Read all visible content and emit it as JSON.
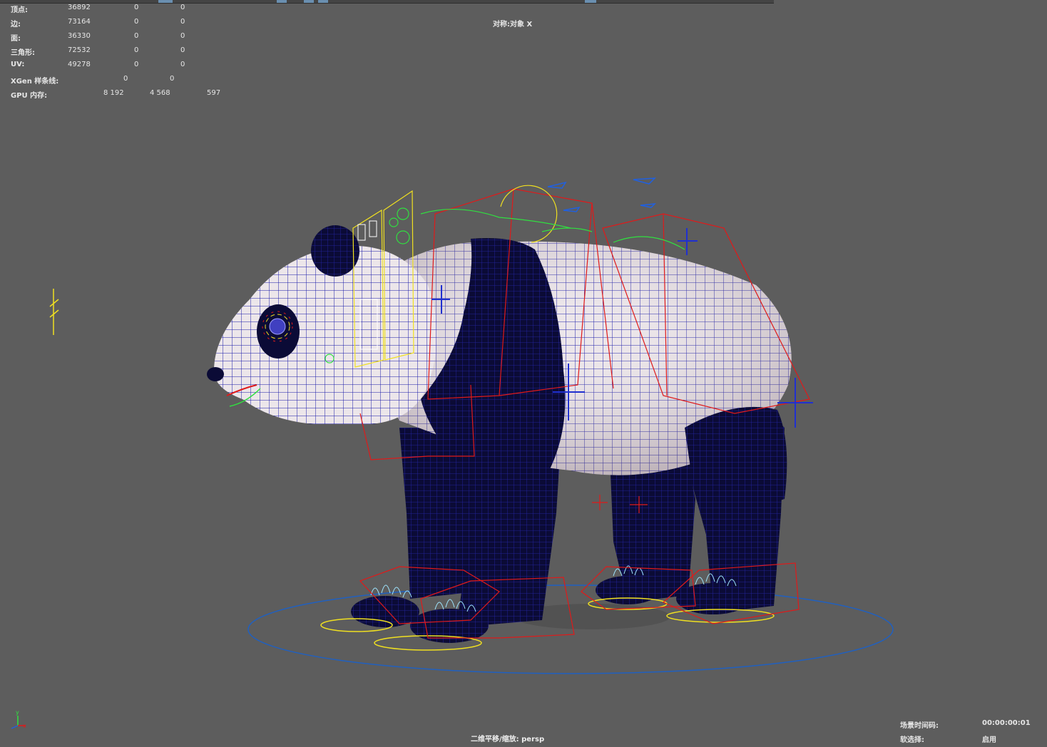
{
  "hud": {
    "rows": [
      {
        "label": "顶点:",
        "values": [
          "36892",
          "0",
          "0"
        ]
      },
      {
        "label": "边:",
        "values": [
          "73164",
          "0",
          "0"
        ]
      },
      {
        "label": "面:",
        "values": [
          "36330",
          "0",
          "0"
        ]
      },
      {
        "label": "三角形:",
        "values": [
          "72532",
          "0",
          "0"
        ]
      },
      {
        "label": "UV:",
        "values": [
          "49278",
          "0",
          "0"
        ]
      },
      {
        "label": "XGen 样条线:",
        "values": [
          "",
          "0",
          "0"
        ]
      },
      {
        "label": "GPU 内存:",
        "values": [
          "8 192",
          "4 568",
          "597"
        ]
      }
    ]
  },
  "viewport": {
    "symmetry_label": "对称:对象 X",
    "camera_label": "二维平移/缩放: persp",
    "timecode_label": "场景时间码:",
    "timecode_value": "00:00:00:01",
    "soft_select_label": "软选择:",
    "soft_select_value": "启用"
  },
  "axis": {
    "y": "y",
    "x": "x"
  },
  "colors": {
    "background": "#5d5d5d",
    "wire_blue": "#1a1aa8",
    "panda_white": "#ece6ea",
    "panda_black": "#0b0b36",
    "rig_red": "#e01a1a",
    "rig_yellow": "#f0e020",
    "rig_green": "#30e040",
    "rig_cyan": "#9fe6ff",
    "ground_ring": "#2060c0"
  }
}
